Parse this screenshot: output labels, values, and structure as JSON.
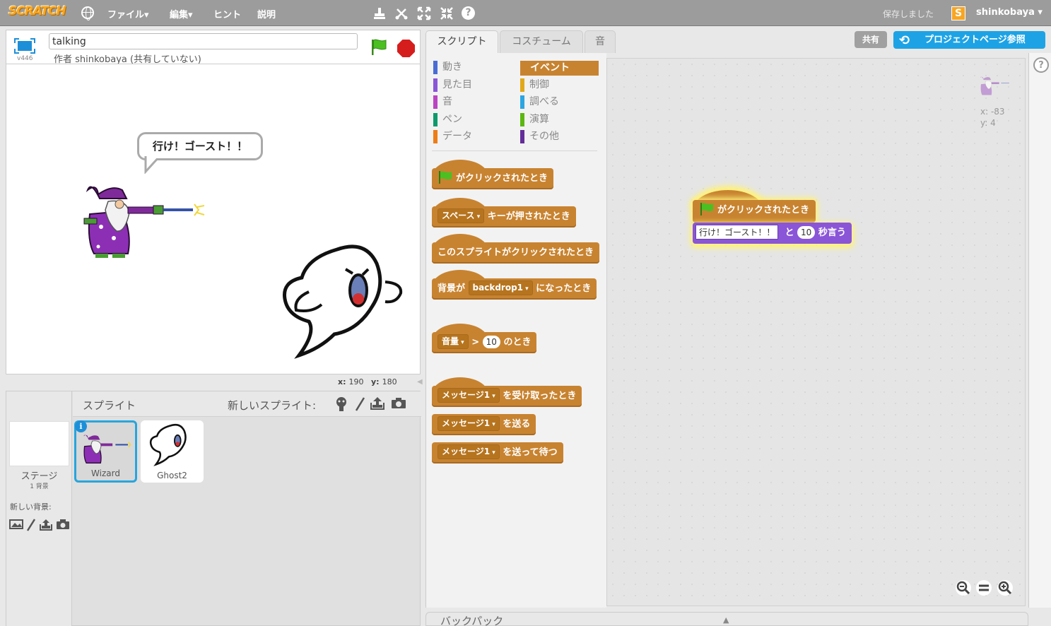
{
  "menubar": {
    "logo": "SCRATCH",
    "file": "ファイル▾",
    "edit": "編集▾",
    "tips": "ヒント",
    "about": "説明",
    "saved": "保存しました",
    "username": "shinkobaya ▾"
  },
  "stage_header": {
    "version": "v446",
    "title": "talking",
    "author": "作者 shinkobaya (共有していない)"
  },
  "stage": {
    "speech": "行け！ゴースト！！",
    "x_label": "x:",
    "x_value": "190",
    "y_label": "y:",
    "y_value": "180"
  },
  "sprite_pane": {
    "title": "スプライト",
    "new_sprite": "新しいスプライト:",
    "stage_label": "ステージ",
    "backdrop_count": "1 背景",
    "new_backdrop": "新しい背景:",
    "sprites": [
      {
        "name": "Wizard",
        "selected": true
      },
      {
        "name": "Ghost2",
        "selected": false
      }
    ]
  },
  "tabs": [
    "スクリプト",
    "コスチューム",
    "音"
  ],
  "buttons": {
    "share": "共有",
    "see_project": "プロジェクトページ参照"
  },
  "categories": {
    "left": [
      {
        "label": "動き",
        "color": "#4a6cd4"
      },
      {
        "label": "見た目",
        "color": "#8a55d7"
      },
      {
        "label": "音",
        "color": "#bb42c3"
      },
      {
        "label": "ペン",
        "color": "#0e9a6c"
      },
      {
        "label": "データ",
        "color": "#ee7d16"
      }
    ],
    "right": [
      {
        "label": "イベント",
        "color": "#c88330"
      },
      {
        "label": "制御",
        "color": "#e1a91a"
      },
      {
        "label": "調べる",
        "color": "#2ca5e2"
      },
      {
        "label": "演算",
        "color": "#5cb712"
      },
      {
        "label": "その他",
        "color": "#632d99"
      }
    ]
  },
  "palette_blocks": {
    "flag_clicked": "がクリックされたとき",
    "key_dd": "スペース",
    "key_text": "キーが押されたとき",
    "sprite_clicked": "このスプライトがクリックされたとき",
    "backdrop_pre": "背景が",
    "backdrop_dd": "backdrop1",
    "backdrop_post": "になったとき",
    "loudness_dd": "音量",
    "gt": ">",
    "loudness_num": "10",
    "loudness_post": "のとき",
    "msg_dd": "メッセージ1",
    "receive": "を受け取ったとき",
    "broadcast": "を送る",
    "broadcast_wait": "を送って待つ"
  },
  "script_area": {
    "sprite_x": "x: -83",
    "sprite_y": "y: 4",
    "hat_label": "がクリックされたとき",
    "say_text": "行け！ゴースト！！",
    "say_and": "と",
    "say_secs": "10",
    "say_post": "秒言う"
  },
  "backpack": {
    "label": "バックパック"
  }
}
